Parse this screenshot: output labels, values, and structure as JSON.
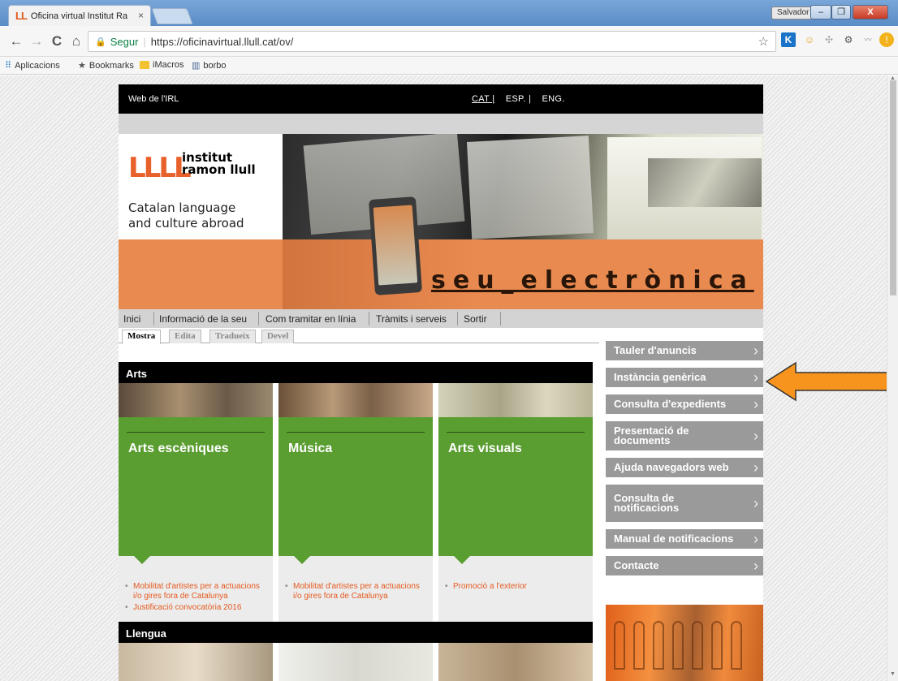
{
  "browser": {
    "tab_title": "Oficina virtual Institut Ra",
    "tab_logo": "LL",
    "tab_close": "×",
    "user_badge": "Salvador",
    "win_min": "–",
    "win_max": "❐",
    "win_close": "X",
    "back": "←",
    "forward": "→",
    "reload": "C",
    "home": "⌂",
    "secure_label": "Segur",
    "url": "https://oficinavirtual.llull.cat/ov/",
    "bookmarks": [
      {
        "icon": "apps-grid-icon",
        "label": "Aplicacions"
      },
      {
        "icon": "star-icon",
        "label": "Bookmarks"
      },
      {
        "icon": "folder-icon",
        "label": "iMacros"
      },
      {
        "icon": "bookmark-icon",
        "label": "borbo"
      }
    ]
  },
  "site": {
    "topbar": {
      "web_link": "Web de l'IRL",
      "langs": [
        "CAT |",
        "ESP. |",
        "ENG."
      ]
    },
    "logo": {
      "mark": "LLLL",
      "line1": "institut",
      "line2": "ramon llull",
      "tagline1": "Catalan language",
      "tagline2": "and culture abroad"
    },
    "banner_title": "seu_electrònica",
    "nav": [
      "Inici",
      "Informació de la seu",
      "Com tramitar en línia",
      "Tràmits i serveis",
      "Sortir"
    ],
    "tabs": [
      "Mostra",
      "Edita",
      "Tradueix",
      "Devel"
    ],
    "sections": [
      {
        "title": "Arts",
        "cards": [
          {
            "title": "Arts escèniques",
            "links": [
              "Mobilitat d'artistes per a actuacions i/o gires fora de Catalunya",
              "Justificació convocatòria 2016"
            ]
          },
          {
            "title": "Música",
            "links": [
              "Mobilitat d'artistes per a actuacions i/o gires fora de Catalunya"
            ]
          },
          {
            "title": "Arts visuals",
            "links": [
              "Promoció a l'exterior"
            ]
          }
        ]
      },
      {
        "title": "Llengua"
      }
    ],
    "sidebar": [
      "Tauler d'anuncis",
      "Instància genèrica",
      "Consulta d'expedients",
      "Presentació de documents",
      "Ajuda navegadors web",
      "Consulta de notificacions",
      "Manual de notificacions",
      "Contacte"
    ],
    "annotation_arrow_color": "#f7941d"
  }
}
